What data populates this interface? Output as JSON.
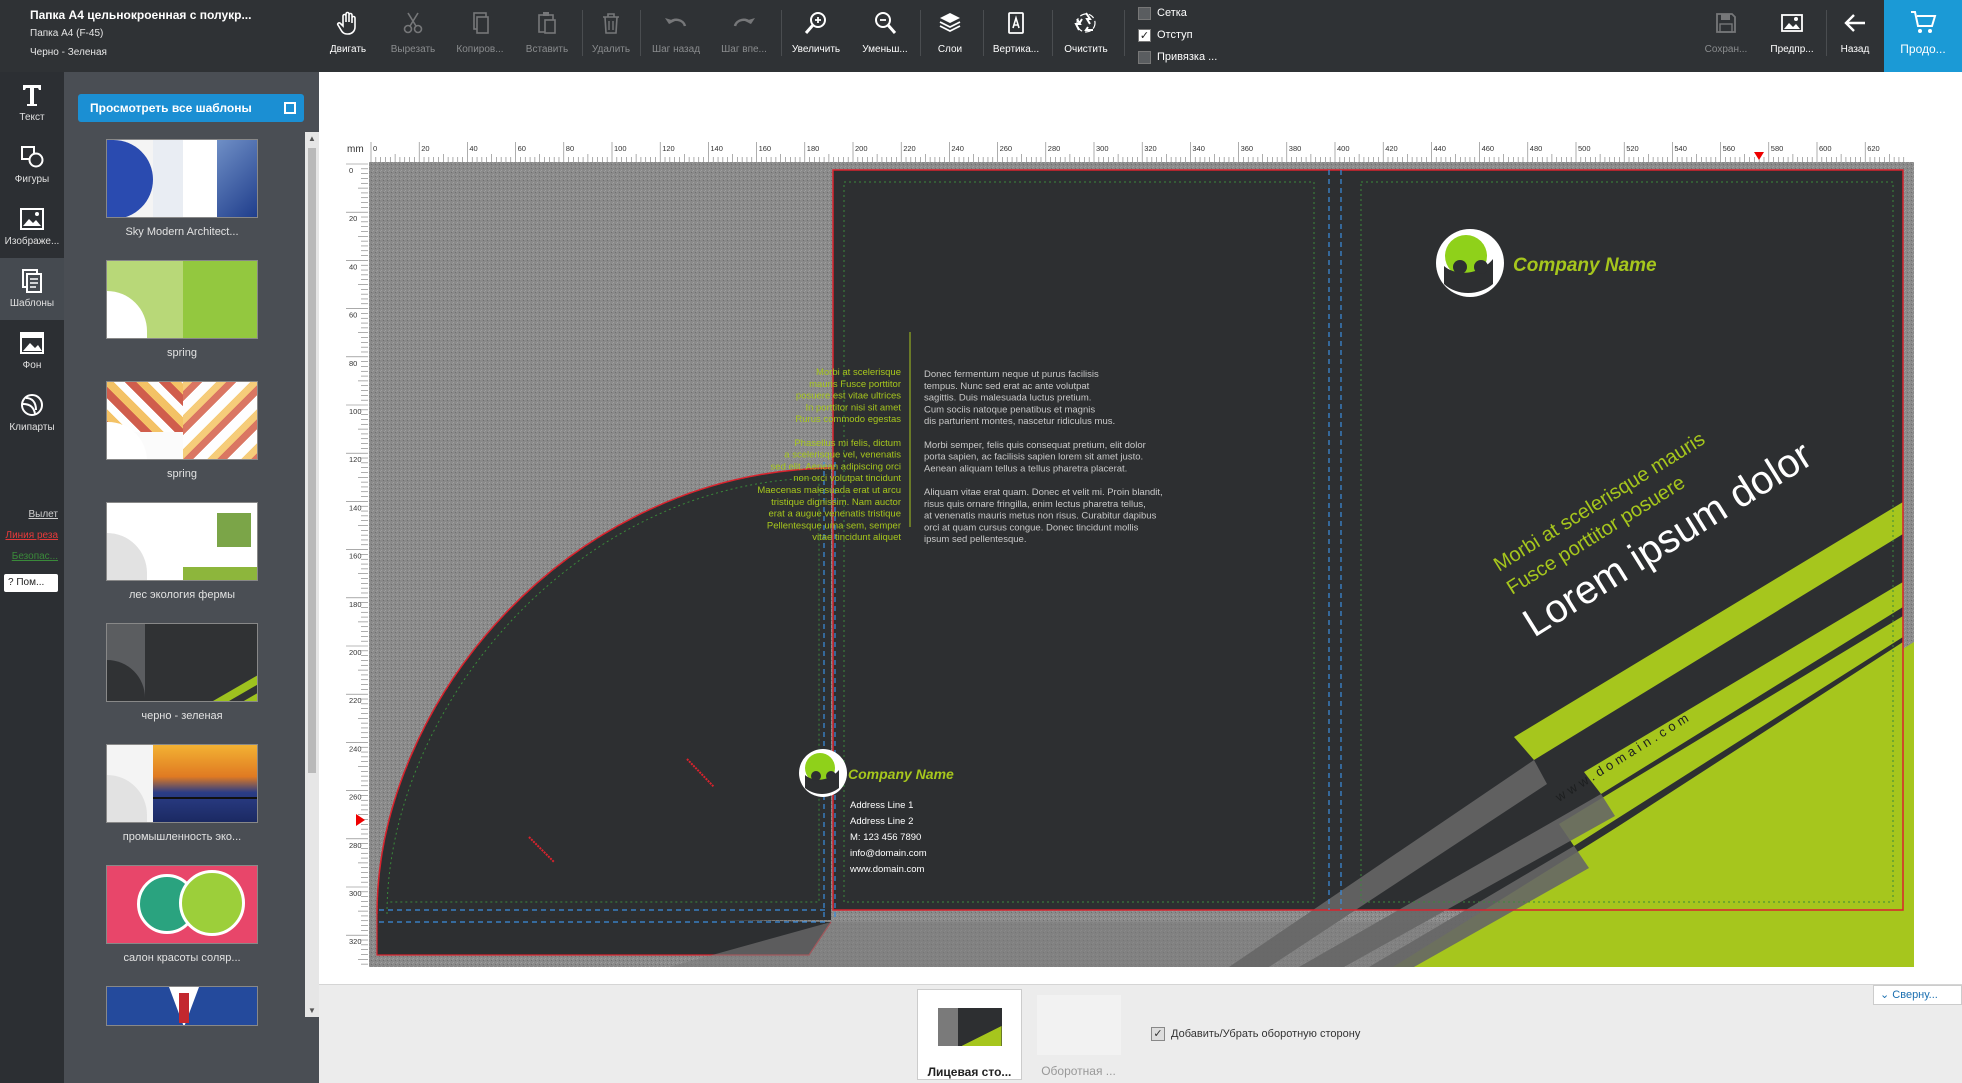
{
  "document": {
    "title": "Папка A4 цельнокроенная с полукр...",
    "format": "Папка A4 (F-45)",
    "template": "Черно - Зеленая"
  },
  "toolbar": {
    "move": "Двигать",
    "cut": "Вырезать",
    "copy": "Копиров...",
    "paste": "Вставить",
    "delete": "Удалить",
    "undo": "Шаг назад",
    "redo": "Шаг впе...",
    "zoom_in": "Увеличить",
    "zoom_out": "Уменьш...",
    "layers": "Слои",
    "vertical": "Вертика...",
    "clear": "Очистить",
    "grid": "Сетка",
    "margin": "Отступ",
    "snap": "Привязка ...",
    "save": "Сохран...",
    "preview": "Предпр...",
    "back": "Назад",
    "proceed": "Продо..."
  },
  "toggles": {
    "grid": false,
    "margin": true,
    "snap": false
  },
  "sidebar": {
    "items": [
      {
        "label": "Текст",
        "icon": "text-icon"
      },
      {
        "label": "Фигуры",
        "icon": "shapes-icon"
      },
      {
        "label": "Изображе...",
        "icon": "image-icon"
      },
      {
        "label": "Шаблоны",
        "icon": "templates-icon"
      },
      {
        "label": "Фон",
        "icon": "background-icon"
      },
      {
        "label": "Клипарты",
        "icon": "clipart-icon"
      }
    ],
    "legend": {
      "bleed": "Вылет",
      "cut_line": "Линия реза",
      "safe_zone": "Безопас..."
    },
    "help": "? Пом..."
  },
  "templates": {
    "view_all": "Просмотреть все шаблоны",
    "items": [
      {
        "name": "Sky Modern Architect..."
      },
      {
        "name": "spring"
      },
      {
        "name": "spring"
      },
      {
        "name": "лес экология фермы"
      },
      {
        "name": "черно - зеленая"
      },
      {
        "name": "промышленность эко..."
      },
      {
        "name": "салон красоты соляр..."
      },
      {
        "name": ""
      }
    ]
  },
  "ruler": {
    "unit": "mm",
    "h_ticks": [
      "0",
      "20",
      "40",
      "60",
      "80",
      "100",
      "120",
      "140",
      "160",
      "180",
      "200",
      "220",
      "240",
      "260",
      "280",
      "300",
      "320",
      "340",
      "360",
      "380",
      "400",
      "420",
      "440",
      "460",
      "480",
      "500",
      "520",
      "540",
      "560",
      "580",
      "600",
      "620"
    ],
    "v_ticks": [
      "0",
      "20",
      "40",
      "60",
      "80",
      "100",
      "120",
      "140",
      "160",
      "180",
      "200",
      "220",
      "240",
      "260",
      "280",
      "300",
      "320"
    ]
  },
  "design": {
    "pocket_text_left": [
      "Morbi at scelerisque",
      "mauris Fusce porttitor",
      "posuere est vitae ultrices",
      "In porttitor nisi sit amet",
      "Rurus commodo egestas",
      "",
      "Phasellus mi felis, dictum",
      "a scelerisque vel, venenatis",
      "sed elit. Aenean adipiscing orci",
      "non orci volutpat tincidunt",
      "Maecenas malesuada erat ut arcu",
      "tristique dignissim. Nam auctor",
      "erat a augue venenatis tristique",
      "Pellentesque urna sem, semper",
      "vitae tincidunt aliquet"
    ],
    "body_text_right": [
      "Donec fermentum neque ut purus facilisis",
      "tempus. Nunc sed erat ac ante volutpat",
      "sagittis. Duis malesuada luctus pretium.",
      "Cum sociis natoque penatibus et magnis",
      "dis parturient montes, nascetur ridiculus mus.",
      "",
      "Morbi semper, felis quis consequat pretium, elit dolor",
      "porta sapien, ac facilisis sapien lorem sit amet justo.",
      "Aenean aliquam tellus a tellus pharetra placerat.",
      "",
      "Aliquam vitae erat quam. Donec et velit mi. Proin blandit,",
      "risus quis ornare fringilla, enim lectus pharetra tellus,",
      "at venenatis mauris metus non risus. Curabitur dapibus",
      "orci at quam cursus congue. Donec tincidunt mollis",
      "ipsum sed pellentesque."
    ],
    "company_name": "Company Name",
    "address_line1": "Address Line 1",
    "address_line2": "Address Line 2",
    "phone": "M: 123 456 7890",
    "email": "info@domain.com",
    "website": "www.domain.com",
    "tagline_line1": "Morbi at scelerisque mauris",
    "tagline_line2": "Fusce porttitor posuere",
    "headline": "Lorem ipsum dolor",
    "domain_vertical": "www.domain.com"
  },
  "pages": {
    "front": "Лицевая сто...",
    "back": "Оборотная ...",
    "add_back": "Добавить/Убрать оборотную сторону",
    "collapse": "Сверну..."
  },
  "colors": {
    "accent_green": "#a6c61d",
    "dark_bg": "#2d2f31",
    "toolbar_bg": "#2f3235",
    "brand_blue": "#1b9ad6",
    "cut_line": "#d9232d",
    "safe_line": "#3a8a3a",
    "fold_line": "#3b8dde"
  }
}
